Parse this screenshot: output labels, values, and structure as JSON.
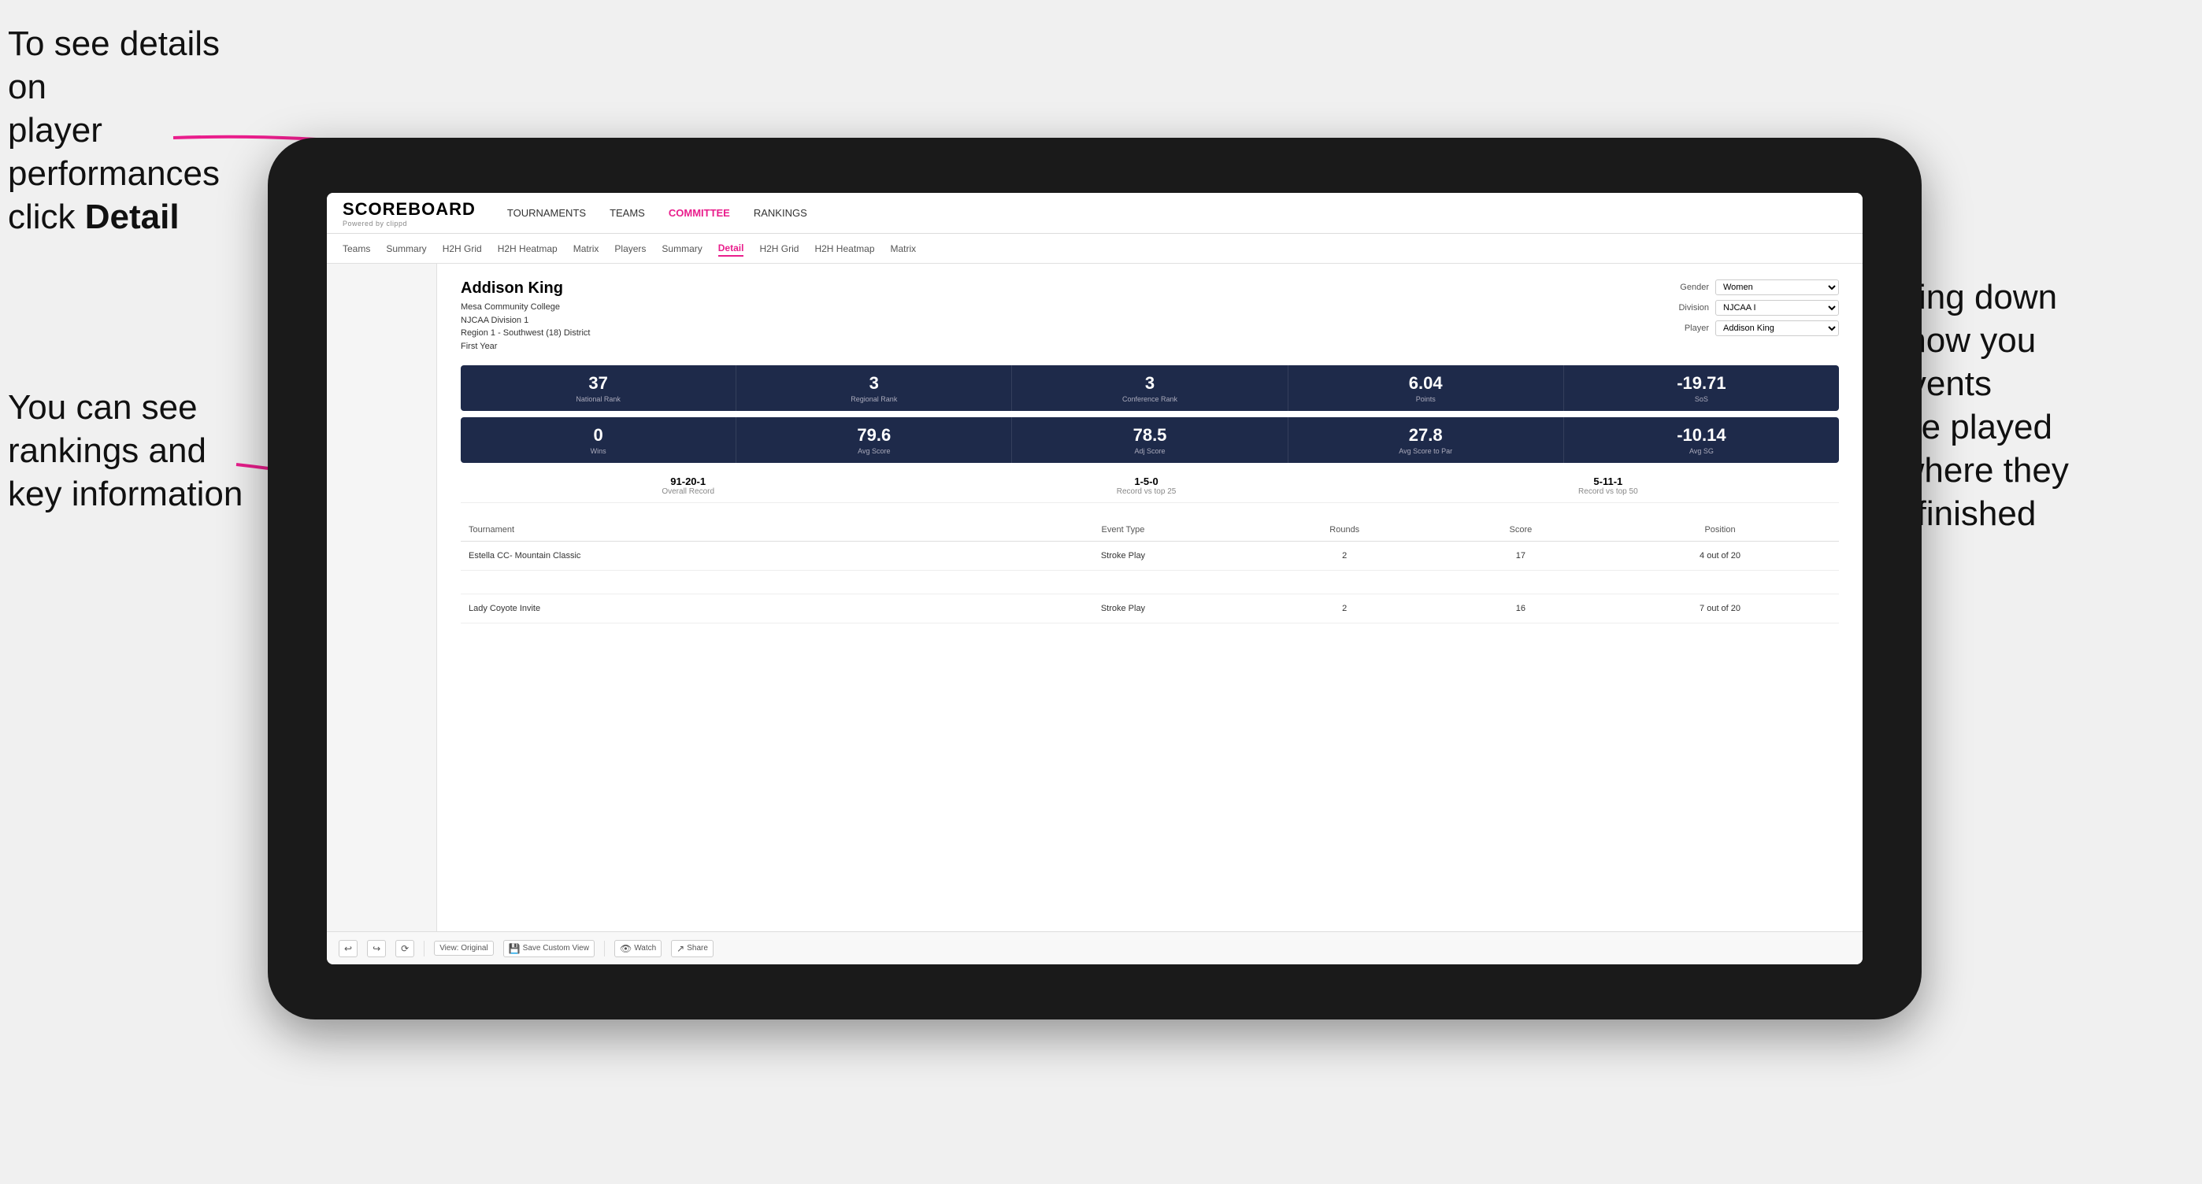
{
  "annotations": {
    "top_left_line1": "To see details on",
    "top_left_line2": "player performances",
    "top_left_line3_pre": "click ",
    "top_left_line3_bold": "Detail",
    "bottom_left_line1": "You can see",
    "bottom_left_line2": "rankings and",
    "bottom_left_line3": "key information",
    "right_line1": "Scrolling down",
    "right_line2": "will show you",
    "right_line3": "the events",
    "right_line4": "they've played",
    "right_line5": "and where they",
    "right_line6": "have finished"
  },
  "nav": {
    "logo": "SCOREBOARD",
    "logo_sub": "Powered by clippd",
    "items": [
      {
        "label": "TOURNAMENTS",
        "active": false
      },
      {
        "label": "TEAMS",
        "active": false
      },
      {
        "label": "COMMITTEE",
        "active": true
      },
      {
        "label": "RANKINGS",
        "active": false
      }
    ]
  },
  "subnav": {
    "items": [
      {
        "label": "Teams",
        "active": false
      },
      {
        "label": "Summary",
        "active": false
      },
      {
        "label": "H2H Grid",
        "active": false
      },
      {
        "label": "H2H Heatmap",
        "active": false
      },
      {
        "label": "Matrix",
        "active": false
      },
      {
        "label": "Players",
        "active": false
      },
      {
        "label": "Summary",
        "active": false
      },
      {
        "label": "Detail",
        "active": true
      },
      {
        "label": "H2H Grid",
        "active": false
      },
      {
        "label": "H2H Heatmap",
        "active": false
      },
      {
        "label": "Matrix",
        "active": false
      }
    ]
  },
  "player": {
    "name": "Addison King",
    "college": "Mesa Community College",
    "division": "NJCAA Division 1",
    "region": "Region 1 - Southwest (18) District",
    "year": "First Year",
    "gender_label": "Gender",
    "gender_value": "Women",
    "division_label": "Division",
    "division_value": "NJCAA I",
    "player_label": "Player",
    "player_value": "Addison King"
  },
  "stats_row1": [
    {
      "value": "37",
      "label": "National Rank"
    },
    {
      "value": "3",
      "label": "Regional Rank"
    },
    {
      "value": "3",
      "label": "Conference Rank"
    },
    {
      "value": "6.04",
      "label": "Points"
    },
    {
      "value": "-19.71",
      "label": "SoS"
    }
  ],
  "stats_row2": [
    {
      "value": "0",
      "label": "Wins"
    },
    {
      "value": "79.6",
      "label": "Avg Score"
    },
    {
      "value": "78.5",
      "label": "Adj Score"
    },
    {
      "value": "27.8",
      "label": "Avg Score to Par"
    },
    {
      "value": "-10.14",
      "label": "Avg SG"
    }
  ],
  "records": [
    {
      "value": "91-20-1",
      "label": "Overall Record"
    },
    {
      "value": "1-5-0",
      "label": "Record vs top 25"
    },
    {
      "value": "5-11-1",
      "label": "Record vs top 50"
    }
  ],
  "table": {
    "headers": [
      "Tournament",
      "Event Type",
      "Rounds",
      "Score",
      "Position"
    ],
    "rows": [
      {
        "tournament": "Estella CC- Mountain Classic",
        "event_type": "Stroke Play",
        "rounds": "2",
        "score": "17",
        "position": "4 out of 20"
      },
      {
        "tournament": "",
        "event_type": "",
        "rounds": "",
        "score": "",
        "position": ""
      },
      {
        "tournament": "Lady Coyote Invite",
        "event_type": "Stroke Play",
        "rounds": "2",
        "score": "16",
        "position": "7 out of 20"
      }
    ]
  },
  "toolbar": {
    "view_label": "View: Original",
    "save_label": "Save Custom View",
    "watch_label": "Watch",
    "share_label": "Share"
  }
}
